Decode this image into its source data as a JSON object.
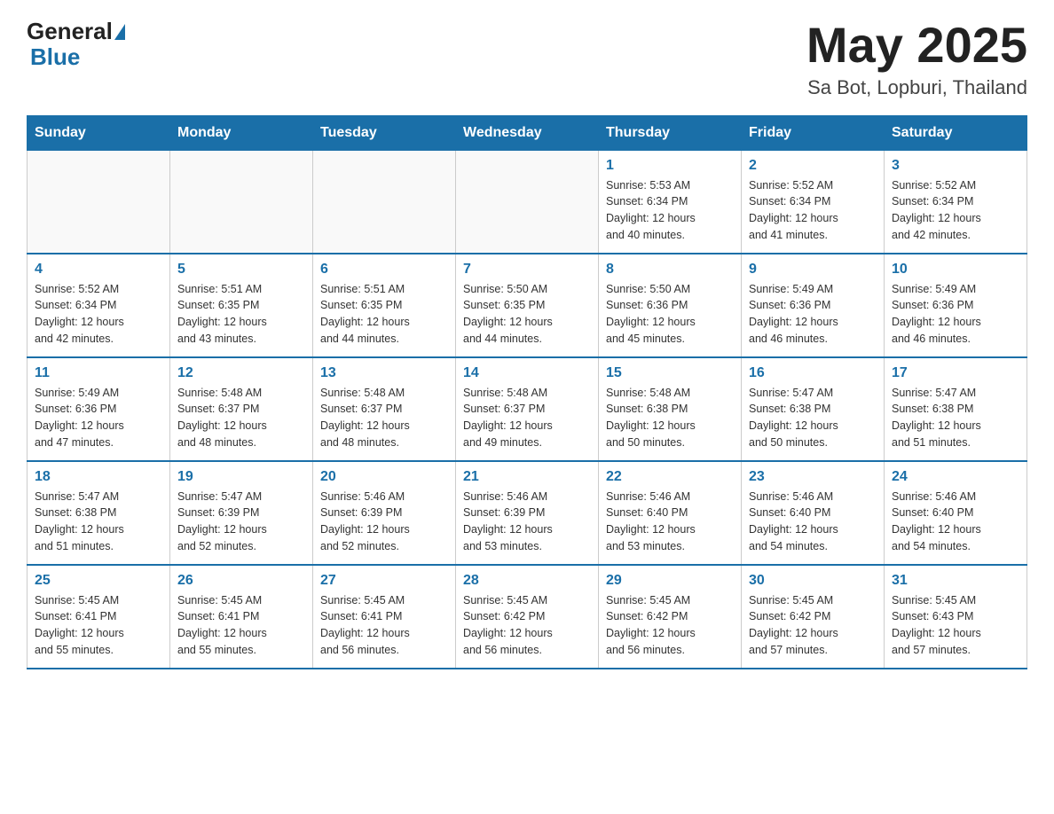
{
  "header": {
    "logo_general": "General",
    "logo_blue": "Blue",
    "month_title": "May 2025",
    "location": "Sa Bot, Lopburi, Thailand"
  },
  "weekdays": [
    "Sunday",
    "Monday",
    "Tuesday",
    "Wednesday",
    "Thursday",
    "Friday",
    "Saturday"
  ],
  "weeks": [
    [
      {
        "day": "",
        "info": ""
      },
      {
        "day": "",
        "info": ""
      },
      {
        "day": "",
        "info": ""
      },
      {
        "day": "",
        "info": ""
      },
      {
        "day": "1",
        "info": "Sunrise: 5:53 AM\nSunset: 6:34 PM\nDaylight: 12 hours\nand 40 minutes."
      },
      {
        "day": "2",
        "info": "Sunrise: 5:52 AM\nSunset: 6:34 PM\nDaylight: 12 hours\nand 41 minutes."
      },
      {
        "day": "3",
        "info": "Sunrise: 5:52 AM\nSunset: 6:34 PM\nDaylight: 12 hours\nand 42 minutes."
      }
    ],
    [
      {
        "day": "4",
        "info": "Sunrise: 5:52 AM\nSunset: 6:34 PM\nDaylight: 12 hours\nand 42 minutes."
      },
      {
        "day": "5",
        "info": "Sunrise: 5:51 AM\nSunset: 6:35 PM\nDaylight: 12 hours\nand 43 minutes."
      },
      {
        "day": "6",
        "info": "Sunrise: 5:51 AM\nSunset: 6:35 PM\nDaylight: 12 hours\nand 44 minutes."
      },
      {
        "day": "7",
        "info": "Sunrise: 5:50 AM\nSunset: 6:35 PM\nDaylight: 12 hours\nand 44 minutes."
      },
      {
        "day": "8",
        "info": "Sunrise: 5:50 AM\nSunset: 6:36 PM\nDaylight: 12 hours\nand 45 minutes."
      },
      {
        "day": "9",
        "info": "Sunrise: 5:49 AM\nSunset: 6:36 PM\nDaylight: 12 hours\nand 46 minutes."
      },
      {
        "day": "10",
        "info": "Sunrise: 5:49 AM\nSunset: 6:36 PM\nDaylight: 12 hours\nand 46 minutes."
      }
    ],
    [
      {
        "day": "11",
        "info": "Sunrise: 5:49 AM\nSunset: 6:36 PM\nDaylight: 12 hours\nand 47 minutes."
      },
      {
        "day": "12",
        "info": "Sunrise: 5:48 AM\nSunset: 6:37 PM\nDaylight: 12 hours\nand 48 minutes."
      },
      {
        "day": "13",
        "info": "Sunrise: 5:48 AM\nSunset: 6:37 PM\nDaylight: 12 hours\nand 48 minutes."
      },
      {
        "day": "14",
        "info": "Sunrise: 5:48 AM\nSunset: 6:37 PM\nDaylight: 12 hours\nand 49 minutes."
      },
      {
        "day": "15",
        "info": "Sunrise: 5:48 AM\nSunset: 6:38 PM\nDaylight: 12 hours\nand 50 minutes."
      },
      {
        "day": "16",
        "info": "Sunrise: 5:47 AM\nSunset: 6:38 PM\nDaylight: 12 hours\nand 50 minutes."
      },
      {
        "day": "17",
        "info": "Sunrise: 5:47 AM\nSunset: 6:38 PM\nDaylight: 12 hours\nand 51 minutes."
      }
    ],
    [
      {
        "day": "18",
        "info": "Sunrise: 5:47 AM\nSunset: 6:38 PM\nDaylight: 12 hours\nand 51 minutes."
      },
      {
        "day": "19",
        "info": "Sunrise: 5:47 AM\nSunset: 6:39 PM\nDaylight: 12 hours\nand 52 minutes."
      },
      {
        "day": "20",
        "info": "Sunrise: 5:46 AM\nSunset: 6:39 PM\nDaylight: 12 hours\nand 52 minutes."
      },
      {
        "day": "21",
        "info": "Sunrise: 5:46 AM\nSunset: 6:39 PM\nDaylight: 12 hours\nand 53 minutes."
      },
      {
        "day": "22",
        "info": "Sunrise: 5:46 AM\nSunset: 6:40 PM\nDaylight: 12 hours\nand 53 minutes."
      },
      {
        "day": "23",
        "info": "Sunrise: 5:46 AM\nSunset: 6:40 PM\nDaylight: 12 hours\nand 54 minutes."
      },
      {
        "day": "24",
        "info": "Sunrise: 5:46 AM\nSunset: 6:40 PM\nDaylight: 12 hours\nand 54 minutes."
      }
    ],
    [
      {
        "day": "25",
        "info": "Sunrise: 5:45 AM\nSunset: 6:41 PM\nDaylight: 12 hours\nand 55 minutes."
      },
      {
        "day": "26",
        "info": "Sunrise: 5:45 AM\nSunset: 6:41 PM\nDaylight: 12 hours\nand 55 minutes."
      },
      {
        "day": "27",
        "info": "Sunrise: 5:45 AM\nSunset: 6:41 PM\nDaylight: 12 hours\nand 56 minutes."
      },
      {
        "day": "28",
        "info": "Sunrise: 5:45 AM\nSunset: 6:42 PM\nDaylight: 12 hours\nand 56 minutes."
      },
      {
        "day": "29",
        "info": "Sunrise: 5:45 AM\nSunset: 6:42 PM\nDaylight: 12 hours\nand 56 minutes."
      },
      {
        "day": "30",
        "info": "Sunrise: 5:45 AM\nSunset: 6:42 PM\nDaylight: 12 hours\nand 57 minutes."
      },
      {
        "day": "31",
        "info": "Sunrise: 5:45 AM\nSunset: 6:43 PM\nDaylight: 12 hours\nand 57 minutes."
      }
    ]
  ]
}
